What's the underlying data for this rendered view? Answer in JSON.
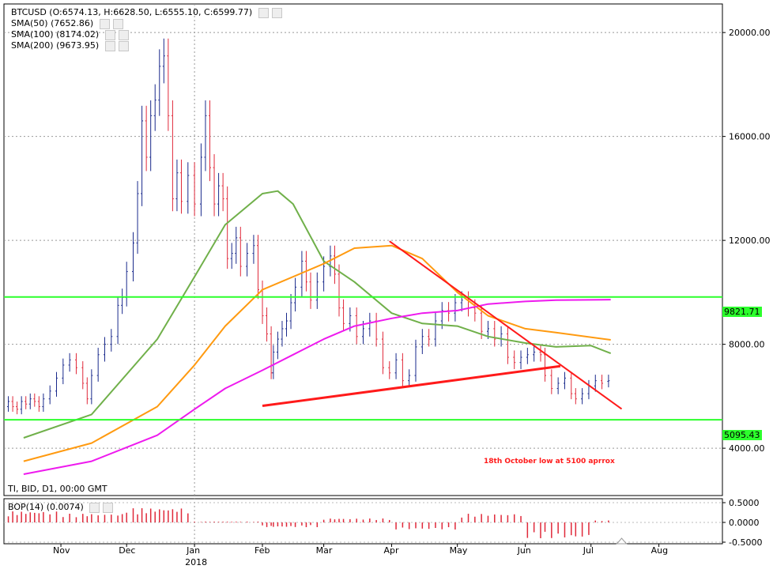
{
  "header": {
    "line1": "BTCUSD (O:6574.13, H:6628.50, L:6555.10, C:6599.77)",
    "line2": "SMA(50) (7652.86)",
    "line3": "SMA(100) (8174.02)",
    "line4": "SMA(200) (9673.95)",
    "footer": "TI, BID, D1, 00:00 GMT"
  },
  "indicator": {
    "label": "BOP(14) (0.0074)"
  },
  "annotation": "18th October low at 5100 aprrox",
  "levels": {
    "upper": "9821.71",
    "lower": "5095.43"
  },
  "colors": {
    "bull": "#1a2a8c",
    "bear": "#e0293a",
    "sma50": "#70b04a",
    "sma100": "#ff9a10",
    "sma200": "#ee1aee",
    "trend": "#ff1a1a",
    "level": "#2cff2c"
  },
  "chart_data": [
    {
      "type": "line",
      "title": "BTCUSD",
      "y_ticks": [
        "20000.00",
        "16000.00",
        "12000.00",
        "8000.00",
        "4000.00"
      ],
      "x_ticks": [
        "Nov",
        "Dec",
        "Jan",
        "Feb",
        "Mar",
        "Apr",
        "May",
        "Jun",
        "Jul",
        "Aug"
      ],
      "x_sublabel": "2018",
      "ylim": [
        3000,
        21100
      ],
      "ohlc": {
        "open": 6574.13,
        "high": 6628.5,
        "low": 6555.1,
        "close": 6599.77
      },
      "series": [
        {
          "name": "SMA(50)",
          "last": 7652.86,
          "points": [
            [
              "2017-10-15",
              4400
            ],
            [
              "2017-11-15",
              5300
            ],
            [
              "2017-12-15",
              8200
            ],
            [
              "2018-01-01",
              10600
            ],
            [
              "2018-01-15",
              12600
            ],
            [
              "2018-02-01",
              13800
            ],
            [
              "2018-02-08",
              13900
            ],
            [
              "2018-02-15",
              13400
            ],
            [
              "2018-03-01",
              11200
            ],
            [
              "2018-03-15",
              10400
            ],
            [
              "2018-04-01",
              9200
            ],
            [
              "2018-04-15",
              8800
            ],
            [
              "2018-05-01",
              8700
            ],
            [
              "2018-05-15",
              8300
            ],
            [
              "2018-06-01",
              8050
            ],
            [
              "2018-06-15",
              7900
            ],
            [
              "2018-07-01",
              7950
            ],
            [
              "2018-07-10",
              7650
            ]
          ]
        },
        {
          "name": "SMA(100)",
          "last": 8174.02,
          "points": [
            [
              "2017-10-15",
              3500
            ],
            [
              "2017-11-15",
              4200
            ],
            [
              "2017-12-15",
              5600
            ],
            [
              "2018-01-01",
              7200
            ],
            [
              "2018-01-15",
              8700
            ],
            [
              "2018-02-01",
              10100
            ],
            [
              "2018-03-01",
              11100
            ],
            [
              "2018-03-15",
              11700
            ],
            [
              "2018-04-01",
              11800
            ],
            [
              "2018-04-15",
              11300
            ],
            [
              "2018-05-01",
              10000
            ],
            [
              "2018-05-15",
              9100
            ],
            [
              "2018-06-01",
              8600
            ],
            [
              "2018-06-15",
              8450
            ],
            [
              "2018-07-10",
              8170
            ]
          ]
        },
        {
          "name": "SMA(200)",
          "last": 9673.95,
          "points": [
            [
              "2017-10-15",
              3000
            ],
            [
              "2017-11-15",
              3500
            ],
            [
              "2017-12-15",
              4500
            ],
            [
              "2018-01-01",
              5500
            ],
            [
              "2018-01-15",
              6300
            ],
            [
              "2018-02-01",
              7000
            ],
            [
              "2018-02-15",
              7600
            ],
            [
              "2018-03-01",
              8200
            ],
            [
              "2018-03-15",
              8700
            ],
            [
              "2018-04-01",
              9000
            ],
            [
              "2018-04-15",
              9200
            ],
            [
              "2018-05-01",
              9300
            ],
            [
              "2018-05-15",
              9550
            ],
            [
              "2018-06-01",
              9650
            ],
            [
              "2018-06-15",
              9700
            ],
            [
              "2018-07-10",
              9720
            ]
          ]
        },
        {
          "name": "Upper trendline",
          "points": [
            [
              "2018-03-31",
              11970
            ],
            [
              "2018-07-15",
              5510
            ]
          ]
        },
        {
          "name": "Lower trendline",
          "points": [
            [
              "2018-02-01",
              5630
            ],
            [
              "2018-06-17",
              7160
            ]
          ]
        }
      ],
      "horizontal_levels": [
        9821.71,
        5095.43
      ],
      "candles": [
        {
          "d": "2017-10-08",
          "o": 5600,
          "c": 5800
        },
        {
          "d": "2017-10-10",
          "o": 5800,
          "c": 5600
        },
        {
          "d": "2017-10-12",
          "o": 5600,
          "c": 5500
        },
        {
          "d": "2017-10-14",
          "o": 5500,
          "c": 5800
        },
        {
          "d": "2017-10-16",
          "o": 5800,
          "c": 5700
        },
        {
          "d": "2017-10-18",
          "o": 5700,
          "c": 5900
        },
        {
          "d": "2017-10-20",
          "o": 5900,
          "c": 5800
        },
        {
          "d": "2017-10-22",
          "o": 5800,
          "c": 5600
        },
        {
          "d": "2017-10-24",
          "o": 5600,
          "c": 5900
        },
        {
          "d": "2017-10-27",
          "o": 5900,
          "c": 6200
        },
        {
          "d": "2017-10-30",
          "o": 6200,
          "c": 6700
        },
        {
          "d": "2017-11-02",
          "o": 6700,
          "c": 7200
        },
        {
          "d": "2017-11-05",
          "o": 7200,
          "c": 7400
        },
        {
          "d": "2017-11-08",
          "o": 7400,
          "c": 7100
        },
        {
          "d": "2017-11-11",
          "o": 7100,
          "c": 6500
        },
        {
          "d": "2017-11-13",
          "o": 6500,
          "c": 5900
        },
        {
          "d": "2017-11-15",
          "o": 5900,
          "c": 6800
        },
        {
          "d": "2017-11-18",
          "o": 6800,
          "c": 7600
        },
        {
          "d": "2017-11-21",
          "o": 7600,
          "c": 8000
        },
        {
          "d": "2017-11-24",
          "o": 8000,
          "c": 8300
        },
        {
          "d": "2017-11-27",
          "o": 8300,
          "c": 9500
        },
        {
          "d": "2017-11-29",
          "o": 9500,
          "c": 9800
        },
        {
          "d": "2017-12-01",
          "o": 9800,
          "c": 10800
        },
        {
          "d": "2017-12-04",
          "o": 10800,
          "c": 11900
        },
        {
          "d": "2017-12-06",
          "o": 11900,
          "c": 13800
        },
        {
          "d": "2017-12-08",
          "o": 13800,
          "c": 16600
        },
        {
          "d": "2017-12-10",
          "o": 16600,
          "c": 15200
        },
        {
          "d": "2017-12-12",
          "o": 15200,
          "c": 16800
        },
        {
          "d": "2017-12-14",
          "o": 16800,
          "c": 17400
        },
        {
          "d": "2017-12-16",
          "o": 17400,
          "c": 18700
        },
        {
          "d": "2017-12-18",
          "o": 18700,
          "c": 19100
        },
        {
          "d": "2017-12-20",
          "o": 19100,
          "c": 16800
        },
        {
          "d": "2017-12-22",
          "o": 16800,
          "c": 13600
        },
        {
          "d": "2017-12-24",
          "o": 13600,
          "c": 14600
        },
        {
          "d": "2017-12-26",
          "o": 14600,
          "c": 13500
        },
        {
          "d": "2017-12-29",
          "o": 13500,
          "c": 14500
        },
        {
          "d": "2018-01-01",
          "o": 14500,
          "c": 13400
        },
        {
          "d": "2018-01-04",
          "o": 13400,
          "c": 15200
        },
        {
          "d": "2018-01-06",
          "o": 15200,
          "c": 16800
        },
        {
          "d": "2018-01-08",
          "o": 16800,
          "c": 14800
        },
        {
          "d": "2018-01-10",
          "o": 14800,
          "c": 13400
        },
        {
          "d": "2018-01-12",
          "o": 13400,
          "c": 14100
        },
        {
          "d": "2018-01-14",
          "o": 14100,
          "c": 13600
        },
        {
          "d": "2018-01-16",
          "o": 13600,
          "c": 11300
        },
        {
          "d": "2018-01-18",
          "o": 11300,
          "c": 11500
        },
        {
          "d": "2018-01-20",
          "o": 11500,
          "c": 12100
        },
        {
          "d": "2018-01-22",
          "o": 12100,
          "c": 11000
        },
        {
          "d": "2018-01-25",
          "o": 11000,
          "c": 11500
        },
        {
          "d": "2018-01-28",
          "o": 11500,
          "c": 11800
        },
        {
          "d": "2018-01-30",
          "o": 11800,
          "c": 10100
        },
        {
          "d": "2018-02-01",
          "o": 10100,
          "c": 9100
        },
        {
          "d": "2018-02-03",
          "o": 9100,
          "c": 8400
        },
        {
          "d": "2018-02-05",
          "o": 8400,
          "c": 6900
        },
        {
          "d": "2018-02-06",
          "o": 6900,
          "c": 7700
        },
        {
          "d": "2018-02-08",
          "o": 7700,
          "c": 8200
        },
        {
          "d": "2018-02-10",
          "o": 8200,
          "c": 8600
        },
        {
          "d": "2018-02-12",
          "o": 8600,
          "c": 8900
        },
        {
          "d": "2018-02-14",
          "o": 8900,
          "c": 9600
        },
        {
          "d": "2018-02-16",
          "o": 9600,
          "c": 10200
        },
        {
          "d": "2018-02-19",
          "o": 10200,
          "c": 11200
        },
        {
          "d": "2018-02-21",
          "o": 11200,
          "c": 10400
        },
        {
          "d": "2018-02-23",
          "o": 10400,
          "c": 9700
        },
        {
          "d": "2018-02-26",
          "o": 9700,
          "c": 10400
        },
        {
          "d": "2018-03-01",
          "o": 10400,
          "c": 11000
        },
        {
          "d": "2018-03-04",
          "o": 11000,
          "c": 11400
        },
        {
          "d": "2018-03-06",
          "o": 11400,
          "c": 10700
        },
        {
          "d": "2018-03-08",
          "o": 10700,
          "c": 9400
        },
        {
          "d": "2018-03-10",
          "o": 9400,
          "c": 8800
        },
        {
          "d": "2018-03-13",
          "o": 8800,
          "c": 9100
        },
        {
          "d": "2018-03-16",
          "o": 9100,
          "c": 8300
        },
        {
          "d": "2018-03-19",
          "o": 8300,
          "c": 8600
        },
        {
          "d": "2018-03-22",
          "o": 8600,
          "c": 8900
        },
        {
          "d": "2018-03-25",
          "o": 8900,
          "c": 8200
        },
        {
          "d": "2018-03-28",
          "o": 8200,
          "c": 7100
        },
        {
          "d": "2018-03-31",
          "o": 7100,
          "c": 6900
        },
        {
          "d": "2018-04-03",
          "o": 6900,
          "c": 7400
        },
        {
          "d": "2018-04-06",
          "o": 7400,
          "c": 6600
        },
        {
          "d": "2018-04-09",
          "o": 6600,
          "c": 6800
        },
        {
          "d": "2018-04-12",
          "o": 6800,
          "c": 7900
        },
        {
          "d": "2018-04-15",
          "o": 7900,
          "c": 8300
        },
        {
          "d": "2018-04-18",
          "o": 8300,
          "c": 8200
        },
        {
          "d": "2018-04-21",
          "o": 8200,
          "c": 8900
        },
        {
          "d": "2018-04-24",
          "o": 8900,
          "c": 9300
        },
        {
          "d": "2018-04-27",
          "o": 9300,
          "c": 9200
        },
        {
          "d": "2018-04-30",
          "o": 9200,
          "c": 9600
        },
        {
          "d": "2018-05-03",
          "o": 9600,
          "c": 9700
        },
        {
          "d": "2018-05-06",
          "o": 9700,
          "c": 9400
        },
        {
          "d": "2018-05-09",
          "o": 9400,
          "c": 9200
        },
        {
          "d": "2018-05-12",
          "o": 9200,
          "c": 8500
        },
        {
          "d": "2018-05-15",
          "o": 8500,
          "c": 8600
        },
        {
          "d": "2018-05-18",
          "o": 8600,
          "c": 8200
        },
        {
          "d": "2018-05-21",
          "o": 8200,
          "c": 8400
        },
        {
          "d": "2018-05-24",
          "o": 8400,
          "c": 7500
        },
        {
          "d": "2018-05-27",
          "o": 7500,
          "c": 7300
        },
        {
          "d": "2018-05-30",
          "o": 7300,
          "c": 7500
        },
        {
          "d": "2018-06-02",
          "o": 7500,
          "c": 7600
        },
        {
          "d": "2018-06-05",
          "o": 7600,
          "c": 7700
        },
        {
          "d": "2018-06-08",
          "o": 7700,
          "c": 7600
        },
        {
          "d": "2018-06-10",
          "o": 7600,
          "c": 6800
        },
        {
          "d": "2018-06-13",
          "o": 6800,
          "c": 6300
        },
        {
          "d": "2018-06-16",
          "o": 6300,
          "c": 6500
        },
        {
          "d": "2018-06-19",
          "o": 6500,
          "c": 6700
        },
        {
          "d": "2018-06-22",
          "o": 6700,
          "c": 6100
        },
        {
          "d": "2018-06-24",
          "o": 6100,
          "c": 5900
        },
        {
          "d": "2018-06-27",
          "o": 5900,
          "c": 6100
        },
        {
          "d": "2018-06-30",
          "o": 6100,
          "c": 6400
        },
        {
          "d": "2018-07-03",
          "o": 6400,
          "c": 6600
        },
        {
          "d": "2018-07-06",
          "o": 6600,
          "c": 6500
        },
        {
          "d": "2018-07-09",
          "o": 6574,
          "c": 6600
        }
      ]
    },
    {
      "type": "bar",
      "title": "BOP(14) (0.0074)",
      "y_ticks": [
        "0.5000",
        "0.0000",
        "-0.5000"
      ],
      "ylim": [
        -0.55,
        0.55
      ],
      "monthly_bop": [
        [
          "2017-10",
          0.28
        ],
        [
          "2017-11",
          0.22
        ],
        [
          "2017-12",
          0.36
        ],
        [
          "2018-01",
          0.02
        ],
        [
          "2018-02",
          -0.12
        ],
        [
          "2018-03",
          0.1
        ],
        [
          "2018-04",
          -0.18
        ],
        [
          "2018-05",
          0.22
        ],
        [
          "2018-06",
          -0.4
        ],
        [
          "2018-07",
          0.05
        ]
      ]
    }
  ]
}
